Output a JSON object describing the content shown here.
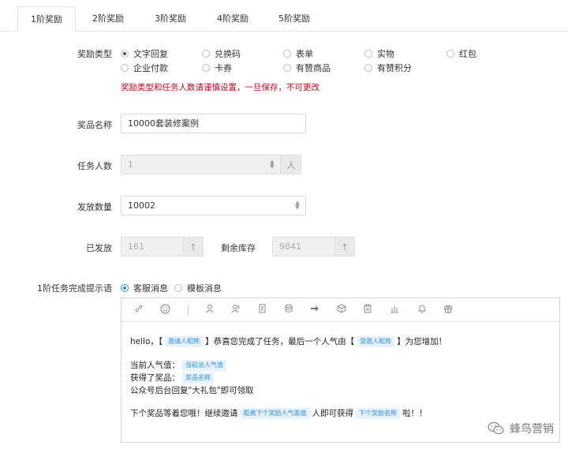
{
  "tabs": [
    {
      "label": "1阶奖励"
    },
    {
      "label": "2阶奖励"
    },
    {
      "label": "3阶奖励"
    },
    {
      "label": "4阶奖励"
    },
    {
      "label": "5阶奖励"
    }
  ],
  "reward_type": {
    "label": "奖励类型",
    "options": [
      {
        "label": "文字回复",
        "selected": true
      },
      {
        "label": "兑换码"
      },
      {
        "label": "表单"
      },
      {
        "label": "实物"
      },
      {
        "label": "红包"
      },
      {
        "label": "企业付款"
      },
      {
        "label": "卡券"
      },
      {
        "label": "有赞商品"
      },
      {
        "label": "有赞积分"
      }
    ],
    "warning": "奖励类型和任务人数请谨慎设置，一旦保存，不可更改"
  },
  "prize_name": {
    "label": "奖品名称",
    "value": "10000套装修案例"
  },
  "task_count": {
    "label": "任务人数",
    "value": "1",
    "unit": "人"
  },
  "quantity": {
    "label": "发放数量",
    "value": "10002"
  },
  "issued": {
    "label": "已发放",
    "value": "161",
    "arrow": "↑"
  },
  "stock": {
    "label": "剩余库存",
    "value": "9841",
    "arrow": "↑"
  },
  "message": {
    "label": "1阶任务完成提示语",
    "options": [
      {
        "label": "客服消息",
        "selected": true
      },
      {
        "label": "模板消息"
      }
    ]
  },
  "editor": {
    "toolbar": [
      "link-icon",
      "emoji-icon",
      "user-icon",
      "users-icon",
      "document-icon",
      "database-icon",
      "arrow-right-icon",
      "box-icon",
      "clipboard-icon",
      "chart-icon",
      "bell-icon",
      "gift-icon"
    ],
    "line1": {
      "a": "hello，【",
      "tag1": "邀请人昵称",
      "b": "】恭喜您完成了任务，最后一个人气由【",
      "tag2": "受邀人昵称",
      "c": "】为您增加！"
    },
    "line2": {
      "a": "当前人气值：",
      "tag": "当前总人气值"
    },
    "line3": {
      "a": "获得了奖品：",
      "tag": "奖品名称"
    },
    "line4": "公众号后台回复\"大礼包\"即可领取",
    "line5": {
      "a": "下个奖品等着您哦！继续邀请",
      "tag1": "距离下个奖励人气差值",
      "b": "人即可获得",
      "tag2": "下个奖励名称",
      "c": "啦！！"
    }
  },
  "watermark": "蜂鸟营销"
}
